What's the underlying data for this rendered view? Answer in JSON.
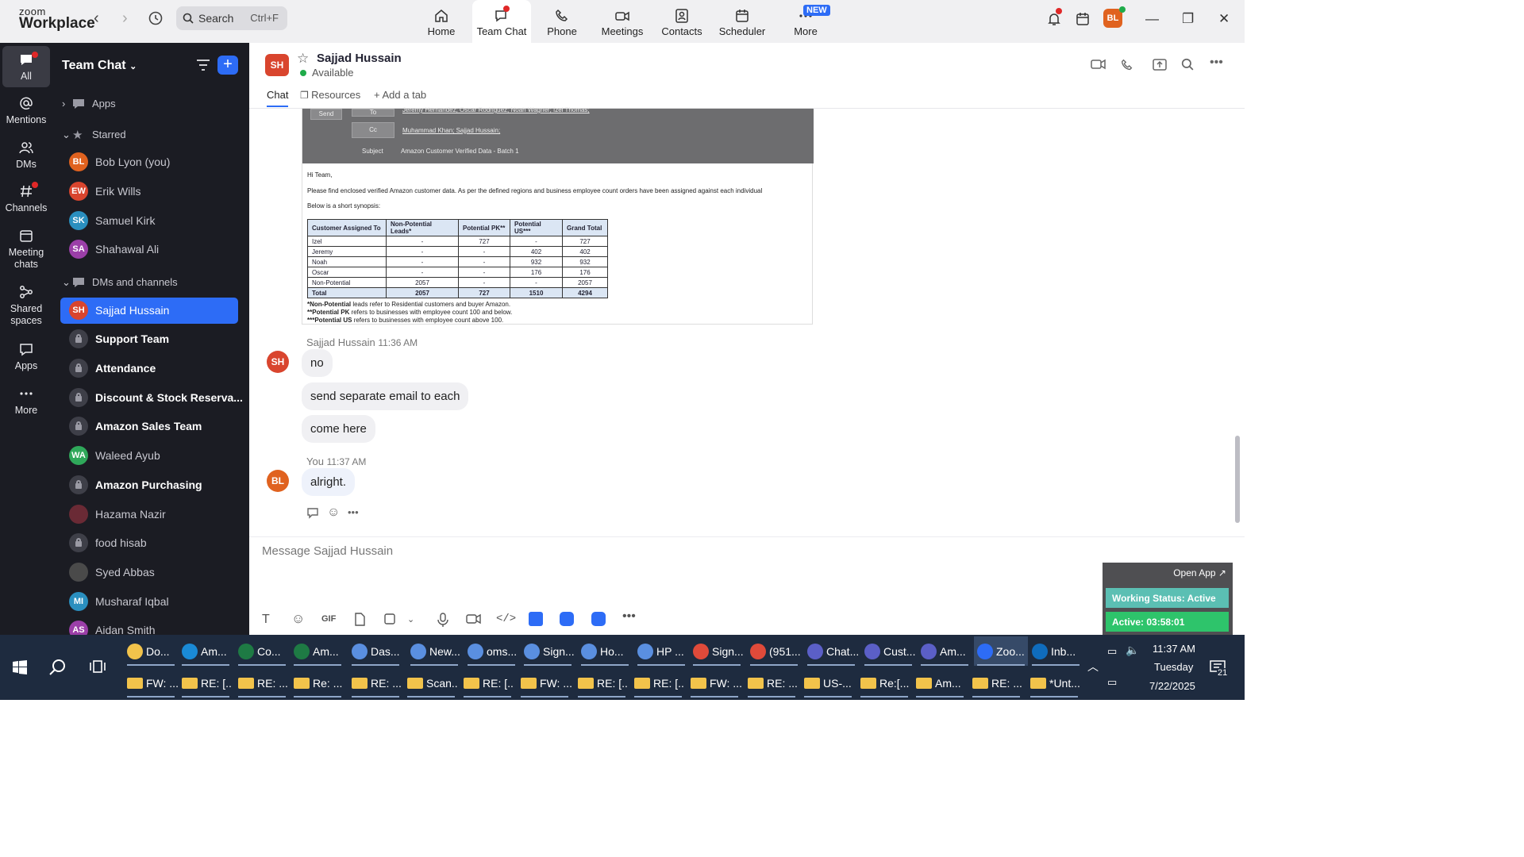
{
  "titlebar": {
    "brand_top": "zoom",
    "brand_bottom": "Workplace",
    "search_placeholder": "Search",
    "search_shortcut": "Ctrl+F",
    "tabs": [
      {
        "label": "Home"
      },
      {
        "label": "Team Chat"
      },
      {
        "label": "Phone"
      },
      {
        "label": "Meetings"
      },
      {
        "label": "Contacts"
      },
      {
        "label": "Scheduler"
      },
      {
        "label": "More"
      }
    ],
    "new_badge": "NEW",
    "user_initials": "BL"
  },
  "rail": [
    {
      "label": "All"
    },
    {
      "label": "Mentions"
    },
    {
      "label": "DMs"
    },
    {
      "label": "Channels"
    },
    {
      "label": "Meeting chats"
    },
    {
      "label": "Shared spaces"
    },
    {
      "label": "Apps"
    },
    {
      "label": "More"
    }
  ],
  "sidebar": {
    "title": "Team Chat",
    "apps_label": "Apps",
    "starred_label": "Starred",
    "starred": [
      {
        "initials": "BL",
        "name": "Bob Lyon (you)",
        "color": "#e0621f"
      },
      {
        "initials": "EW",
        "name": "Erik Wills",
        "color": "#d9452e"
      },
      {
        "initials": "SK",
        "name": "Samuel Kirk",
        "color": "#2a8fbf"
      },
      {
        "initials": "SA",
        "name": "Shahawal Ali",
        "color": "#9b3fa8"
      }
    ],
    "dms_label": "DMs and channels",
    "dms": [
      {
        "initials": "SH",
        "name": "Sajjad Hussain",
        "type": "avatar",
        "color": "#d9452e"
      },
      {
        "name": "Support Team",
        "type": "channel"
      },
      {
        "name": "Attendance",
        "type": "channel"
      },
      {
        "name": "Discount & Stock Reserva...",
        "type": "channel"
      },
      {
        "name": "Amazon Sales Team",
        "type": "channel"
      },
      {
        "initials": "WA",
        "name": "Waleed Ayub",
        "type": "avatar",
        "color": "#2fa85a"
      },
      {
        "name": "Amazon Purchasing",
        "type": "channel"
      },
      {
        "initials": "",
        "name": "Hazama Nazir",
        "type": "avatar",
        "color": "#6a2a35"
      },
      {
        "name": "food hisab",
        "type": "channel"
      },
      {
        "initials": "",
        "name": "Syed Abbas",
        "type": "avatar",
        "color": "#4a4a4a"
      },
      {
        "initials": "MI",
        "name": "Musharaf Iqbal",
        "type": "avatar",
        "color": "#2a8fbf"
      },
      {
        "initials": "AS",
        "name": "Aidan Smith",
        "type": "avatar",
        "color": "#9b3fa8"
      }
    ]
  },
  "chat": {
    "contact_initials": "SH",
    "contact_name": "Sajjad Hussain",
    "status": "Available",
    "tabs": [
      "Chat",
      "Resources",
      "Add a tab"
    ],
    "email": {
      "send": "Send",
      "to": "To",
      "to_list": "Jeremy Hernandez;  Oscar Rodriguez;  Noah Wagner;  Izel Thomas;",
      "cc": "Cc",
      "cc_list": "Muhammad Khan;  Sajjad Hussain;",
      "subject_label": "Subject",
      "subject": "Amazon Customer Verified Data - Batch 1",
      "greeting": "Hi Team,",
      "body": "Please find enclosed verified Amazon customer data. As per the defined regions and business employee count orders have been assigned against each individual",
      "synopsis": "Below is a short synopsis:",
      "columns": [
        "Customer Assigned To",
        "Non-Potential Leads*",
        "Potential PK**",
        "Potential US***",
        "Grand Total"
      ],
      "rows": [
        [
          "Izel",
          "-",
          "727",
          "-",
          "727"
        ],
        [
          "Jeremy",
          "-",
          "-",
          "402",
          "402"
        ],
        [
          "Noah",
          "-",
          "-",
          "932",
          "932"
        ],
        [
          "Oscar",
          "-",
          "-",
          "176",
          "176"
        ],
        [
          "Non-Potential",
          "2057",
          "-",
          "-",
          "2057"
        ]
      ],
      "total": [
        "Total",
        "2057",
        "727",
        "1510",
        "4294"
      ],
      "notes": [
        {
          "b": "*Non-Potential",
          "t": " leads refer to Residential customers and buyer Amazon."
        },
        {
          "b": "**Potential PK",
          "t": " refers to businesses with employee count 100 and below."
        },
        {
          "b": "***Potential US",
          "t": " refers to businesses with employee count above 100."
        }
      ]
    },
    "messages": [
      {
        "sender": "Sajjad Hussain",
        "time": "11:36 AM",
        "texts": [
          "no",
          "send separate email to each",
          "come here"
        ]
      },
      {
        "sender": "You",
        "time": "11:37 AM",
        "texts": [
          "alright."
        ]
      }
    ],
    "me_initials": "BL",
    "compose_placeholder": "Message Sajjad Hussain",
    "gif": "GIF"
  },
  "widget": {
    "open_app": "Open App ↗",
    "working_status": "Working Status: Active",
    "active": "Active: 03:58:01"
  },
  "taskbar": {
    "row1": [
      {
        "label": "Do...",
        "color": "#f2c34b"
      },
      {
        "label": "Am...",
        "color": "#1a8ad6"
      },
      {
        "label": "Co...",
        "color": "#1e7a44"
      },
      {
        "label": "Am...",
        "color": "#1e7a44"
      },
      {
        "label": "Das...",
        "color": "#5a8fe0"
      },
      {
        "label": "New...",
        "color": "#5a8fe0"
      },
      {
        "label": "oms...",
        "color": "#5a8fe0"
      },
      {
        "label": "Sign...",
        "color": "#5a8fe0"
      },
      {
        "label": "Ho...",
        "color": "#5a8fe0"
      },
      {
        "label": "HP ...",
        "color": "#5a8fe0"
      },
      {
        "label": "Sign...",
        "color": "#e04a3a"
      },
      {
        "label": "(951...",
        "color": "#e04a3a"
      },
      {
        "label": "Chat...",
        "color": "#5b5fc7"
      },
      {
        "label": "Cust...",
        "color": "#5b5fc7"
      },
      {
        "label": "Am...",
        "color": "#5b5fc7"
      },
      {
        "label": "Zoo...",
        "color": "#2d6cf6"
      },
      {
        "label": "Inb...",
        "color": "#0f6cbd"
      }
    ],
    "row2": [
      {
        "label": "FW: ..."
      },
      {
        "label": "RE: [..."
      },
      {
        "label": "RE: ..."
      },
      {
        "label": "Re: ..."
      },
      {
        "label": "RE: ..."
      },
      {
        "label": "Scan..."
      },
      {
        "label": "RE: [..."
      },
      {
        "label": "FW: ..."
      },
      {
        "label": "RE: [..."
      },
      {
        "label": "RE: [..."
      },
      {
        "label": "FW: ..."
      },
      {
        "label": "RE: ..."
      },
      {
        "label": "US-..."
      },
      {
        "label": "Re:[..."
      },
      {
        "label": "Am..."
      },
      {
        "label": "RE: ..."
      },
      {
        "label": "*Unt..."
      }
    ],
    "time": "11:37 AM",
    "day": "Tuesday",
    "date": "7/22/2025",
    "notif_count": "21"
  }
}
